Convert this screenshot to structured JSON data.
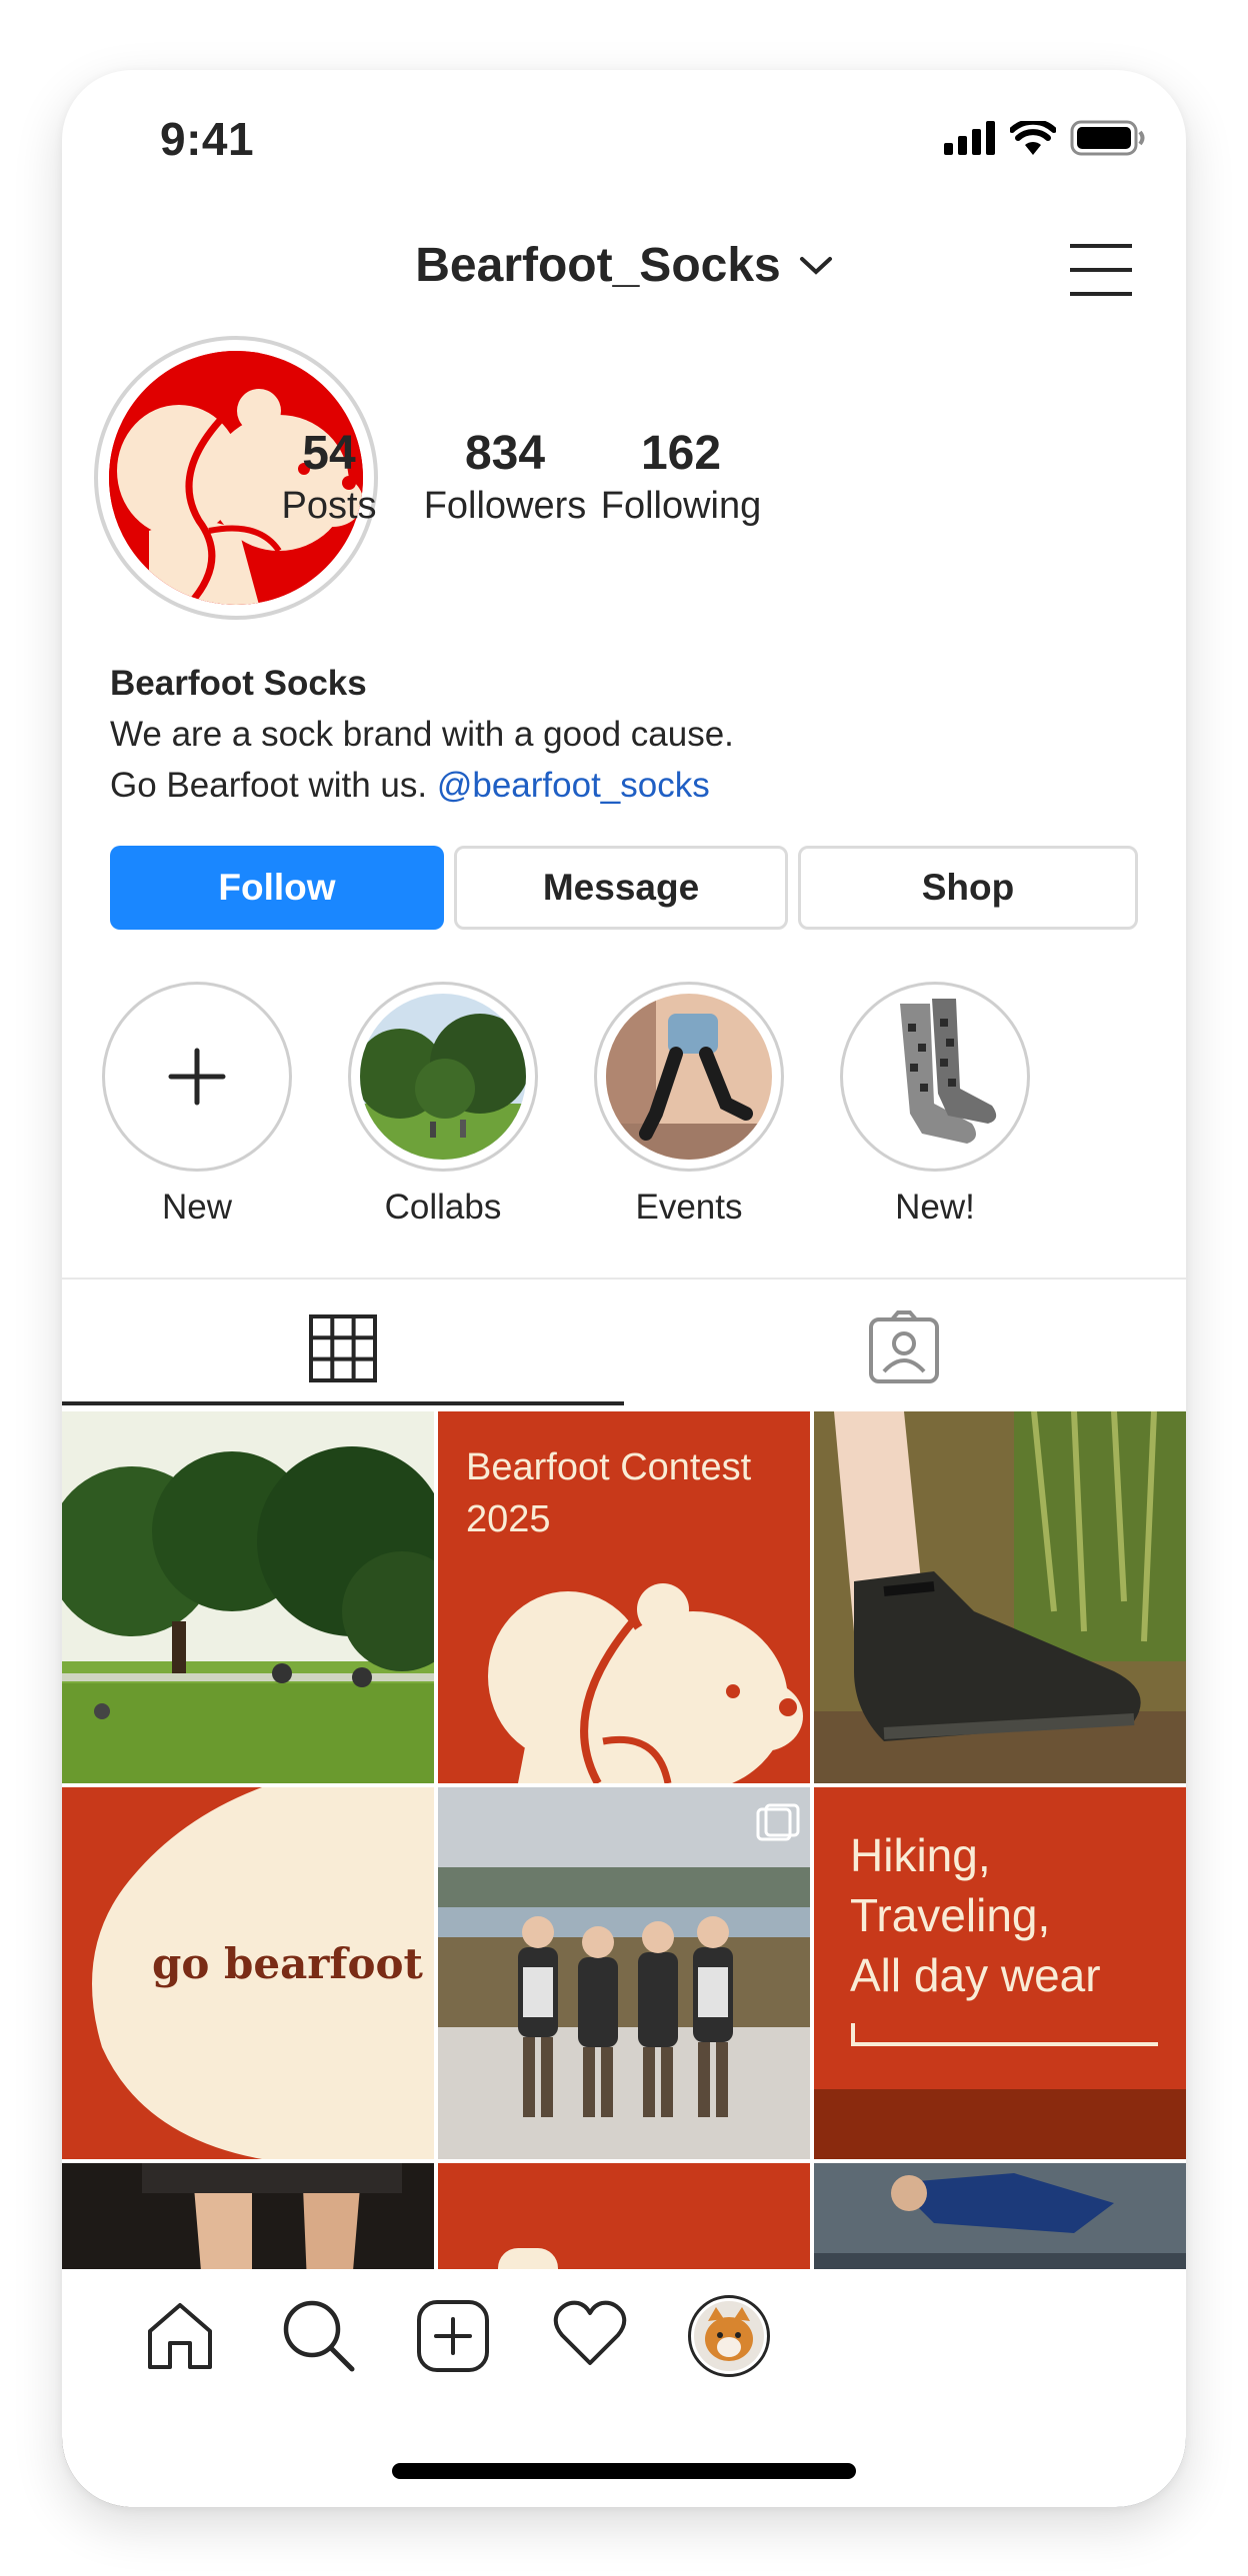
{
  "status_bar": {
    "time": "9:41"
  },
  "header": {
    "username": "Bearfoot_Socks"
  },
  "profile": {
    "stats": [
      {
        "number": "54",
        "label": "Posts"
      },
      {
        "number": "834",
        "label": "Followers"
      },
      {
        "number": "162",
        "label": "Following"
      }
    ],
    "bio": {
      "name": "Bearfoot Socks",
      "line1": "We are a sock brand with a good cause.",
      "line2": "Go Bearfoot with us.",
      "mention": "@bearfoot_socks"
    },
    "buttons": {
      "follow": "Follow",
      "message": "Message",
      "shop": "Shop"
    }
  },
  "highlights": [
    {
      "label": "New"
    },
    {
      "label": "Collabs"
    },
    {
      "label": "Events"
    },
    {
      "label": "New!"
    }
  ],
  "posts": {
    "contest_title_1": "Bearfoot Contest",
    "contest_title_2": "2025",
    "go_bearfoot": "go bearfoot",
    "hiking_1": "Hiking,",
    "hiking_2": "Traveling,",
    "hiking_3": "All day wear"
  },
  "colors": {
    "brand_red": "#c8391a",
    "avatar_red": "#e00000",
    "cream": "#f9ecd6",
    "follow_blue": "#1a87ff",
    "link_blue": "#1f5fc4"
  }
}
